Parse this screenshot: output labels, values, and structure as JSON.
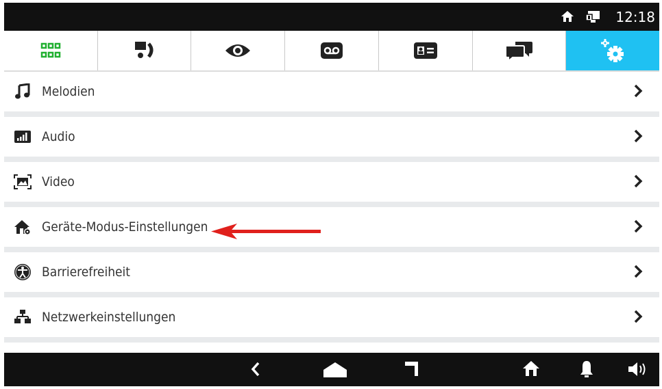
{
  "status": {
    "time": "12:18",
    "icons": [
      "home-icon",
      "intercom-device-icon"
    ]
  },
  "tabs": [
    {
      "name": "apps-grid-icon",
      "active": false
    },
    {
      "name": "intercom-call-icon",
      "active": false
    },
    {
      "name": "eye-icon",
      "active": false
    },
    {
      "name": "voicemail-icon",
      "active": false
    },
    {
      "name": "contact-card-icon",
      "active": false
    },
    {
      "name": "chat-bubbles-icon",
      "active": true,
      "color": "#1fc1f2",
      "icon": "settings-gear-icon"
    }
  ],
  "menu": {
    "items": [
      {
        "label": "Melodien",
        "icon": "music-note-icon"
      },
      {
        "label": "Audio",
        "icon": "audio-level-icon"
      },
      {
        "label": "Video",
        "icon": "video-frame-icon"
      },
      {
        "label": "Geräte-Modus-Einstellungen",
        "icon": "home-settings-icon"
      },
      {
        "label": "Barrierefreiheit",
        "icon": "accessibility-icon"
      },
      {
        "label": "Netzwerkeinstellungen",
        "icon": "network-icon"
      }
    ]
  },
  "annotation": {
    "color": "#e0201c",
    "icon": "red-arrow-left-icon"
  },
  "navbar": {
    "icons": [
      "back-icon",
      "home-nav-icon",
      "recents-icon",
      "home-icon",
      "bell-icon",
      "volume-icon"
    ]
  }
}
